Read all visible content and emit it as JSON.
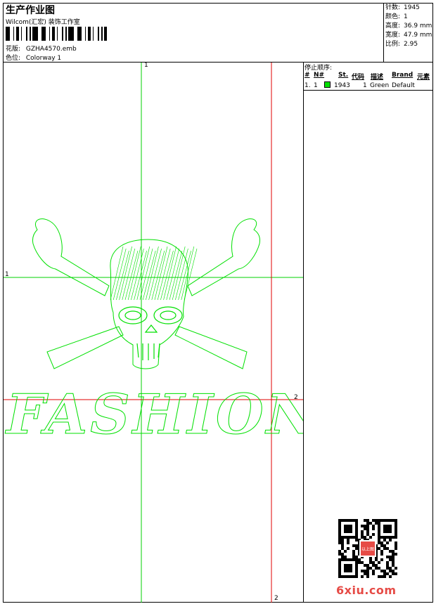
{
  "header": {
    "title": "生产作业图",
    "subtitle": "Wilcom(汇宏) 装饰工作室",
    "pattern_label": "花版:",
    "pattern_value": "GZHA4570.emb",
    "colorway_label": "色位:",
    "colorway_value": "Colorway 1"
  },
  "stats": [
    {
      "label": "针数:",
      "value": "1945"
    },
    {
      "label": "颜色:",
      "value": "1"
    },
    {
      "label": "高度:",
      "value": "36.9 mm"
    },
    {
      "label": "宽度:",
      "value": "47.9 mm"
    },
    {
      "label": "比例:",
      "value": "2.95"
    }
  ],
  "stop_sequence": {
    "heading": "停止顺序:",
    "columns": [
      "#",
      "N#",
      "St.",
      "代码",
      "描述",
      "Brand",
      "元素"
    ],
    "rows": [
      {
        "num": "1.",
        "n": "1",
        "color": "#00e000",
        "stitches": "1943",
        "code": "1",
        "desc": "Green",
        "brand": "Default",
        "element": ""
      }
    ]
  },
  "guides": {
    "top_label": "1",
    "left_label": "1",
    "right_label": "2",
    "bottom_label": "2"
  },
  "design": {
    "text": "FASHION",
    "thread_color": "#00e000",
    "guide_green": "#00d000",
    "guide_red": "#e00000"
  },
  "watermark": {
    "site": "6xiu.com",
    "seal_text": "以上图"
  }
}
